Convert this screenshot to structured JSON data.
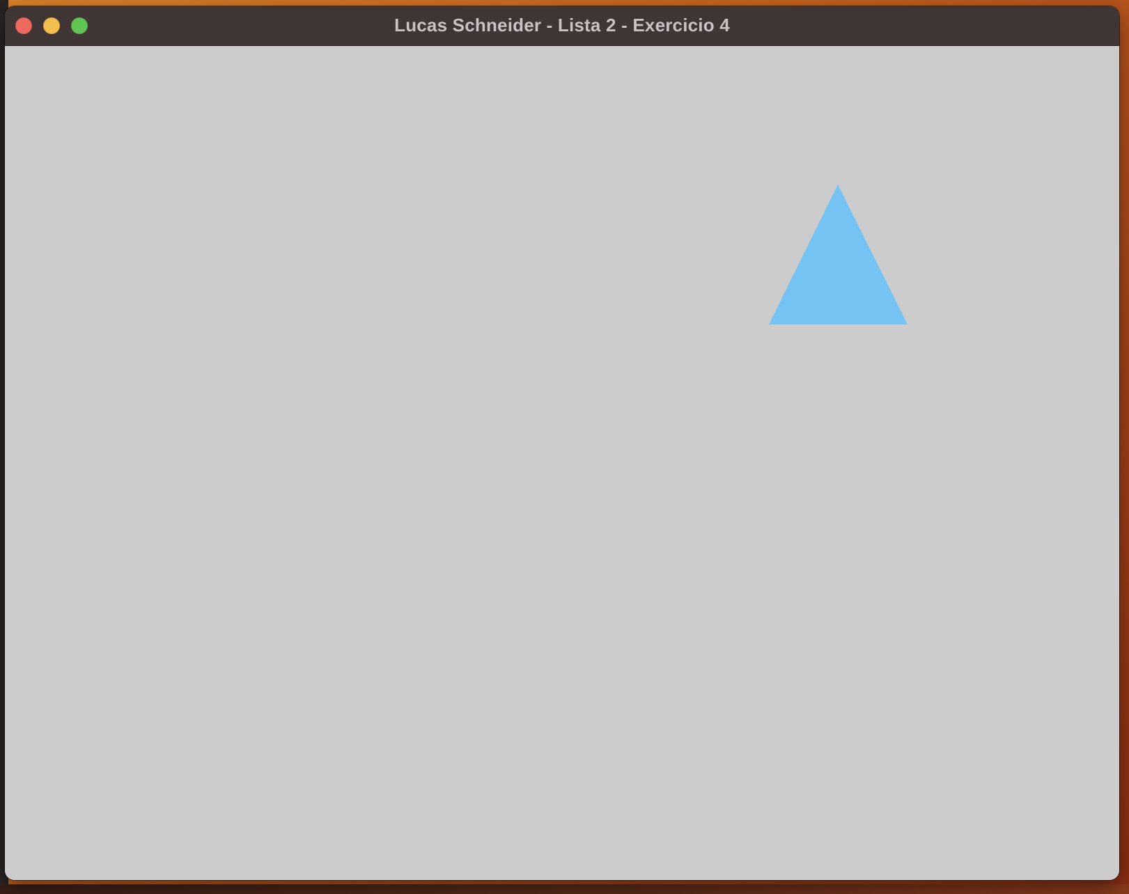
{
  "window": {
    "title": "Lucas Schneider - Lista 2 - Exercicio 4"
  },
  "canvas": {
    "background_color": "#cccccc",
    "shape": {
      "type": "triangle",
      "color": "#75c3f3"
    }
  },
  "titlebar": {
    "background_color": "#3f3535",
    "buttons": {
      "close_color": "#ed6a5e",
      "minimize_color": "#f5bf4f",
      "zoom_color": "#61c554"
    }
  }
}
